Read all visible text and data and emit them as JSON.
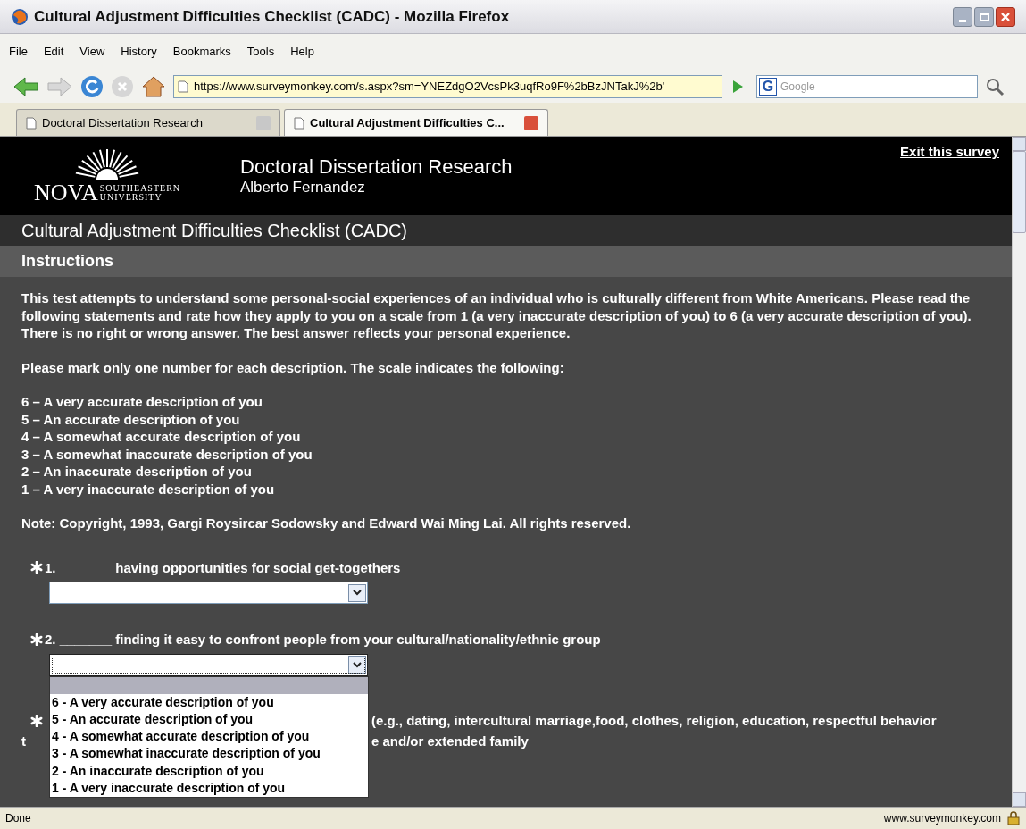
{
  "window": {
    "title": "Cultural Adjustment Difficulties Checklist (CADC) - Mozilla Firefox"
  },
  "menu": [
    "File",
    "Edit",
    "View",
    "History",
    "Bookmarks",
    "Tools",
    "Help"
  ],
  "address_bar": {
    "value": "https://www.surveymonkey.com/s.aspx?sm=YNEZdgO2VcsPk3uqfRo9F%2bBzJNTakJ%2b'"
  },
  "search": {
    "engine_badge": "G",
    "placeholder": "Google"
  },
  "tabs": [
    {
      "label": "Doctoral Dissertation Research",
      "selected": false
    },
    {
      "label": "Cultural Adjustment Difficulties C...",
      "selected": true
    }
  ],
  "header": {
    "logo_word": "NOVA",
    "logo_sub": [
      "SOUTHEASTERN",
      "UNIVERSITY"
    ],
    "title": "Doctoral Dissertation Research",
    "subtitle": "Alberto Fernandez",
    "exit_link": "Exit this survey"
  },
  "survey_title": "Cultural Adjustment Difficulties Checklist (CADC)",
  "section": "Instructions",
  "intro": "This test attempts to understand some personal-social experiences of an individual who is culturally different from White Americans. Please read the following statements and rate how they apply to you on a scale from 1 (a very inaccurate description of you) to 6 (a very accurate description of you). There is no right or wrong answer. The best answer reflects your personal experience.",
  "scale_intro": "Please mark only one number for each description. The scale indicates the following:",
  "scale": [
    "6 – A very accurate description of you",
    "5 – An accurate description of you",
    "4 – A somewhat accurate description of you",
    "3 – A somewhat inaccurate description of you",
    "2 – An inaccurate description of you",
    "1 – A very inaccurate description of you"
  ],
  "note": "Note: Copyright, 1993, Gargi Roysircar Sodowsky and Edward Wai Ming Lai. All rights reserved.",
  "questions": [
    {
      "number": "1.",
      "blank": "_______",
      "text": "having opportunities for social get-togethers",
      "dropdown": {
        "expanded": false
      }
    },
    {
      "number": "2.",
      "blank": "_______",
      "text": "finding it easy to confront people from your cultural/nationality/ethnic group",
      "dropdown": {
        "expanded": true,
        "blank_option_highlighted": true,
        "options": [
          "6 - A very accurate description of you",
          "5 - An accurate description of you",
          "4 - A somewhat accurate description of you",
          "3 - A somewhat inaccurate description of you",
          "2 - An inaccurate description of you",
          "1 - A very inaccurate description of you"
        ]
      }
    }
  ],
  "partial_question": {
    "lines": [
      {
        "right": "(e.g., dating, intercultural marriage,food, clothes, religion, education, respectful behavior"
      },
      {
        "left": "t",
        "right": "e and/or extended family"
      }
    ]
  },
  "status_bar": {
    "text": "Done",
    "site": "www.surveymonkey.com"
  }
}
